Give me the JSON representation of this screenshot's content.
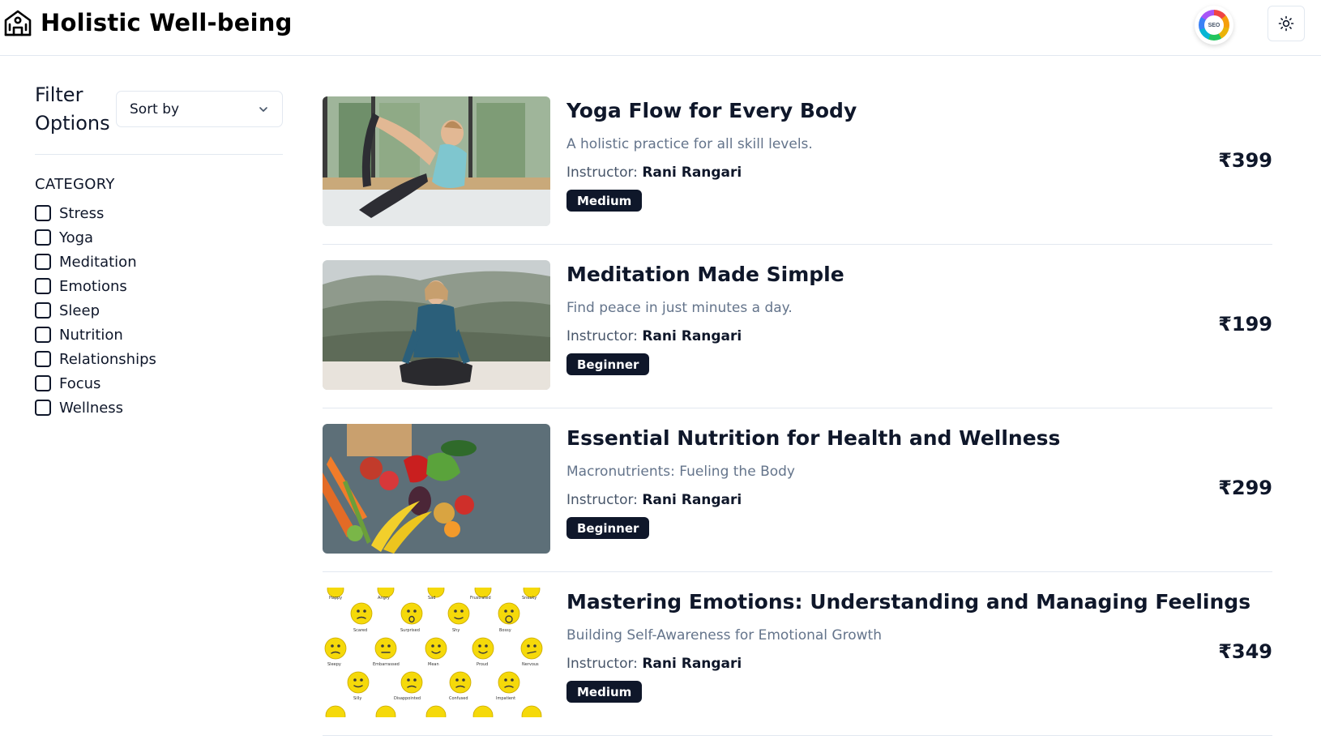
{
  "header": {
    "brand_title": "Holistic Well-being",
    "seo_badge_text": "SEO"
  },
  "sidebar": {
    "filter_title": "Filter Options",
    "sort_placeholder": "Sort by",
    "category_title": "CATEGORY",
    "categories": [
      "Stress",
      "Yoga",
      "Meditation",
      "Emotions",
      "Sleep",
      "Nutrition",
      "Relationships",
      "Focus",
      "Wellness"
    ]
  },
  "courses": [
    {
      "title": "Yoga Flow for Every Body",
      "description": "A holistic practice for all skill levels.",
      "instructor_label": "Instructor:",
      "instructor": "Rani Rangari",
      "level": "Medium",
      "price": "₹399"
    },
    {
      "title": "Meditation Made Simple",
      "description": "Find peace in just minutes a day.",
      "instructor_label": "Instructor:",
      "instructor": "Rani Rangari",
      "level": "Beginner",
      "price": "₹199"
    },
    {
      "title": "Essential Nutrition for Health and Wellness",
      "description": "Macronutrients: Fueling the Body",
      "instructor_label": "Instructor:",
      "instructor": "Rani Rangari",
      "level": "Beginner",
      "price": "₹299"
    },
    {
      "title": "Mastering Emotions: Understanding and Managing Feelings",
      "description": "Building Self-Awareness for Emotional Growth",
      "instructor_label": "Instructor:",
      "instructor": "Rani Rangari",
      "level": "Medium",
      "price": "₹349"
    }
  ],
  "colors": {
    "primary_dark": "#0f172a",
    "muted_text": "#64748b",
    "border": "#e2e8f0"
  }
}
